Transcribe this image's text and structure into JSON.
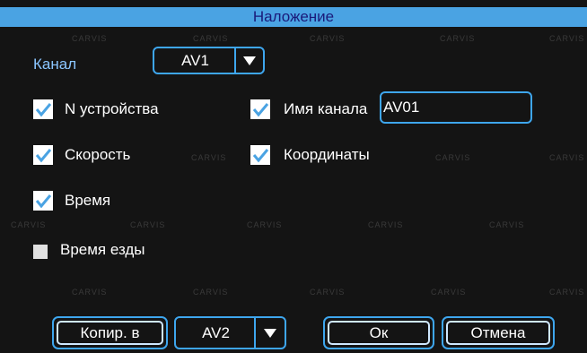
{
  "dialog": {
    "title": "Наложение",
    "channel_label": "Канал",
    "channel_value": "AV1",
    "options": {
      "device_no": {
        "label": "N устройства",
        "checked": true
      },
      "channel_name": {
        "label": "Имя канала",
        "checked": true,
        "value": "AV01"
      },
      "speed": {
        "label": "Скорость",
        "checked": true
      },
      "coordinates": {
        "label": "Координаты",
        "checked": true
      },
      "time": {
        "label": "Время",
        "checked": true
      },
      "drive_time": {
        "label": "Время езды",
        "checked": false
      }
    },
    "footer": {
      "copy_label": "Копир. в",
      "copy_target": "AV2",
      "ok_label": "Ок",
      "cancel_label": "Отмена"
    },
    "watermark": "CARVIS",
    "colors": {
      "accent": "#3ea6ee",
      "title_bg": "#4aa3e3",
      "check": "#4aa3e3"
    }
  }
}
